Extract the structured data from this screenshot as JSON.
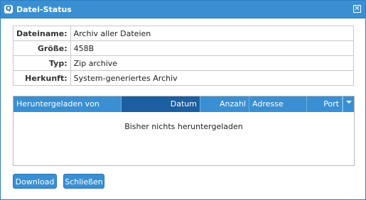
{
  "window": {
    "title": "Datei-Status",
    "close_glyph": "✕"
  },
  "info": {
    "rows": [
      {
        "label": "Dateiname:",
        "value": "Archiv aller Dateien"
      },
      {
        "label": "Größe:",
        "value": "458B"
      },
      {
        "label": "Typ:",
        "value": "Zip archive"
      },
      {
        "label": "Herkunft:",
        "value": "System-generiertes Archiv"
      }
    ]
  },
  "downloads": {
    "columns": [
      "Heruntergeladen von",
      "Datum",
      "Anzahl",
      "Adresse",
      "Port"
    ],
    "empty_text": "Bisher nichts heruntergeladen"
  },
  "buttons": {
    "download": "Download",
    "close": "Schließen"
  },
  "colors": {
    "accent": "#3a8fd3",
    "sorted_column": "#1c5ea0"
  }
}
